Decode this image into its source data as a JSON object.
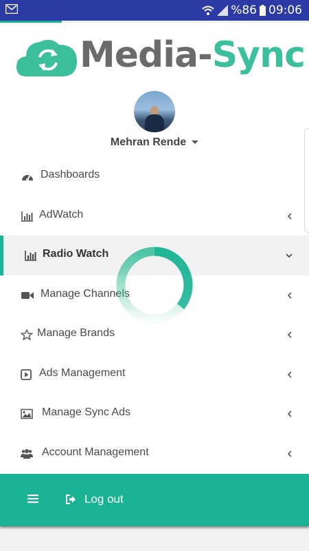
{
  "status_bar": {
    "battery_text": "%86",
    "time": "09:06",
    "icons": [
      "mail-icon",
      "wifi-icon",
      "signal-icon",
      "battery-icon"
    ]
  },
  "app": {
    "logo_word_1": "Media-",
    "logo_word_2": "Sync",
    "accent_color": "#19b394"
  },
  "user": {
    "name": "Mehran Rende"
  },
  "menu": [
    {
      "label": "Dashboards",
      "icon": "dashboard-icon",
      "chevron": "none"
    },
    {
      "label": "AdWatch",
      "icon": "bar-chart-icon",
      "chevron": "left"
    },
    {
      "label": "Radio Watch",
      "icon": "bar-chart-icon",
      "chevron": "down",
      "active": true
    },
    {
      "label": "Manage Channels",
      "icon": "video-camera-icon",
      "chevron": "left"
    },
    {
      "label": "Manage Brands",
      "icon": "star-icon",
      "chevron": "left"
    },
    {
      "label": "Ads Management",
      "icon": "play-square-icon",
      "chevron": "left"
    },
    {
      "label": "Manage Sync Ads",
      "icon": "image-icon",
      "chevron": "left"
    },
    {
      "label": "Account Management",
      "icon": "users-icon",
      "chevron": "left"
    }
  ],
  "footer": {
    "logout_label": "Log out"
  }
}
